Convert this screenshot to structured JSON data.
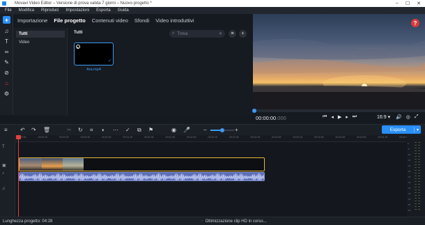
{
  "window": {
    "title": "Movavi Video Editor – Versione di prova valida 7 giorni – Nuovo progetto *",
    "controls": [
      "–",
      "☐",
      "✕"
    ]
  },
  "menu": [
    "File",
    "Modifica",
    "Riproduci",
    "Impostazioni",
    "Esporta",
    "Guida"
  ],
  "tabs": [
    "Importazione",
    "File progetto",
    "Contenuti video",
    "Sfondi",
    "Video introduttivi"
  ],
  "active_tab": "File progetto",
  "categories": [
    "Tutti",
    "Video"
  ],
  "files": {
    "title": "Tutti",
    "search_placeholder": "Trova",
    "items": [
      {
        "name": "Ara.mp4"
      }
    ]
  },
  "preview": {
    "timecode": "00:00:00",
    "frames": ".000",
    "aspect": "16:9 ▾",
    "help": "?"
  },
  "timeline": {
    "ruler": [
      "00:00:00",
      "00:00:15",
      "00:00:30",
      "00:00:45",
      "00:01:00",
      "00:01:15",
      "00:01:30",
      "00:01:45",
      "00:02:00",
      "00:02:15",
      "00:02:30",
      "00:02:45",
      "00:03:00",
      "00:03:15",
      "00:03:30",
      "00:03:45",
      "00:04:00",
      "00:04:15",
      "00:04:30"
    ],
    "zoom_level": 0.5,
    "meter_labels": [
      "0",
      "-5",
      "-10",
      "-15",
      "-20",
      "-25",
      "-30",
      "-35",
      "-40",
      "-45",
      "-50",
      "-55",
      "-60"
    ]
  },
  "export": {
    "label": "Esporta",
    "dropdown": "▾"
  },
  "status": {
    "project_length": "Lunghezza progetto: 04:28",
    "optimization": "Ottimizzazione clip HD in corso..."
  },
  "colors": {
    "accent": "#2a8ff7",
    "clip_border": "#e3b53a",
    "playhead": "#e0413c",
    "help": "#d63b3b"
  }
}
